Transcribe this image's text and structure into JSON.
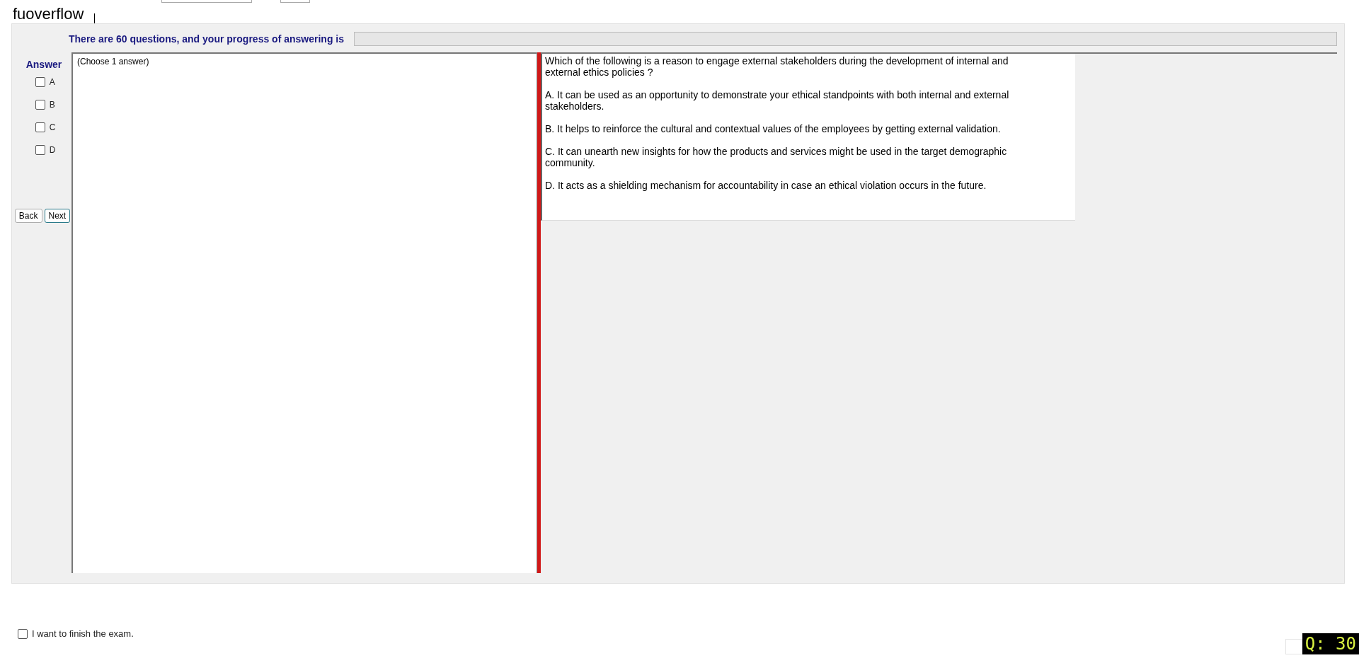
{
  "header": {
    "title": "fuoverflow"
  },
  "progress": {
    "label": "There are 60 questions, and your progress of answering is",
    "level": 0
  },
  "answer_panel": {
    "title": "Answer",
    "options": [
      {
        "label": "A",
        "checked": false
      },
      {
        "label": "B",
        "checked": false
      },
      {
        "label": "C",
        "checked": false
      },
      {
        "label": "D",
        "checked": false
      }
    ],
    "buttons": [
      {
        "label": "Back",
        "focused": false
      },
      {
        "label": "Next",
        "focused": true
      }
    ]
  },
  "answer_area": {
    "hint": "(Choose 1 answer)"
  },
  "question": {
    "text": "Which of the following is a reason to engage external stakeholders during the development of internal and external ethics policies ?",
    "choices": [
      "A.  It can be used as an opportunity to demonstrate your ethical standpoints with both internal and external stakeholders.",
      "B.  It helps to reinforce the cultural and contextual values of the employees by getting external validation.",
      "C.  It can unearth new insights for how the products and services might be used in the target demographic community.",
      "D.  It acts as a shielding mechanism for accountability in case an ethical violation occurs in the future."
    ]
  },
  "footer": {
    "finish": {
      "label": "I want to finish the exam.",
      "checked": false
    },
    "counter": "Q: 30"
  }
}
